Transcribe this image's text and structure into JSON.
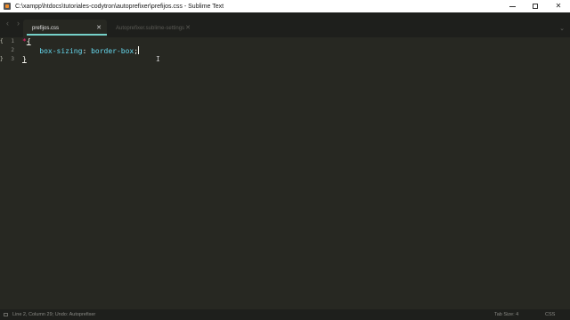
{
  "window": {
    "title": "C:\\xampp\\htdocs\\tutoriales-codytron\\autoprefixer\\prefijos.css - Sublime Text",
    "minimize_icon": "minimize-icon",
    "maximize_icon": "maximize-icon",
    "close_glyph": "✕"
  },
  "nav": {
    "back": "‹",
    "forward": "›"
  },
  "tabs": [
    {
      "label": "prefijos.css",
      "close": "✕",
      "active": true
    },
    {
      "label": "Autoprefixer.sublime-settings",
      "close": "✕",
      "active": false
    }
  ],
  "tab_menu": "⌄",
  "editor": {
    "line_numbers": [
      "1",
      "2",
      "3"
    ],
    "fold_markers": [
      "{",
      "",
      "}"
    ],
    "line1": {
      "selector": "*",
      "brace": "{"
    },
    "line2": {
      "indent": "    ",
      "property": "box-sizing",
      "colon": ": ",
      "value": "border-box",
      "semi": ";"
    },
    "line3": {
      "brace": "}"
    },
    "mouse_cursor": "I"
  },
  "status": {
    "left": "Line 2, Column 29; Undo: Autoprefixer",
    "tab_size": "Tab Size: 4",
    "syntax": "CSS"
  },
  "colors": {
    "editor_bg": "#272822",
    "chrome_bg": "#1e1f1c",
    "tab_accent": "#75d1c9",
    "selector": "#f92672",
    "keyword": "#66d9ef"
  }
}
